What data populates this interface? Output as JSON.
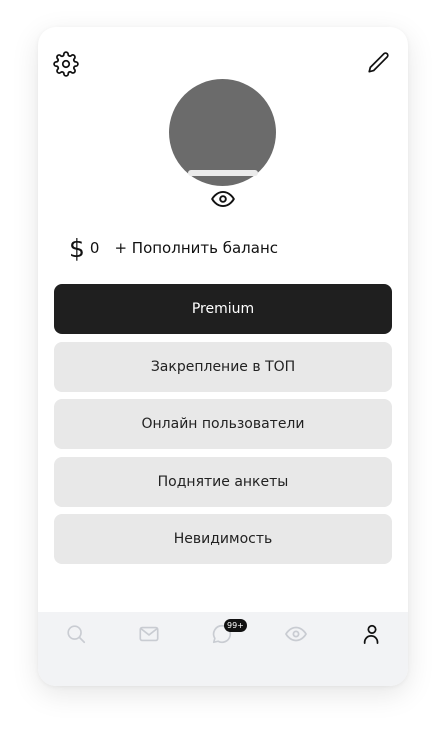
{
  "profile": {
    "balance_symbol": "$",
    "balance_amount": "0",
    "topup_label": "+ Пополнить баланс"
  },
  "services": [
    {
      "label": "Premium"
    },
    {
      "label": "Закрепление в ТОП"
    },
    {
      "label": "Онлайн пользователи"
    },
    {
      "label": "Поднятие анкеты"
    },
    {
      "label": "Невидимость"
    }
  ],
  "tabbar": {
    "messages_badge": "99+",
    "tabs": [
      {
        "icon": "search-icon"
      },
      {
        "icon": "mail-icon"
      },
      {
        "icon": "chat-icon"
      },
      {
        "icon": "eye-icon"
      },
      {
        "icon": "user-icon"
      }
    ]
  },
  "colors": {
    "primary_button": "#1f1f1f",
    "secondary_button": "#e8e8e8",
    "avatar": "#6b6b6b",
    "tabbar_bg": "#f2f3f5",
    "inactive_icon": "#c9ccd2"
  }
}
